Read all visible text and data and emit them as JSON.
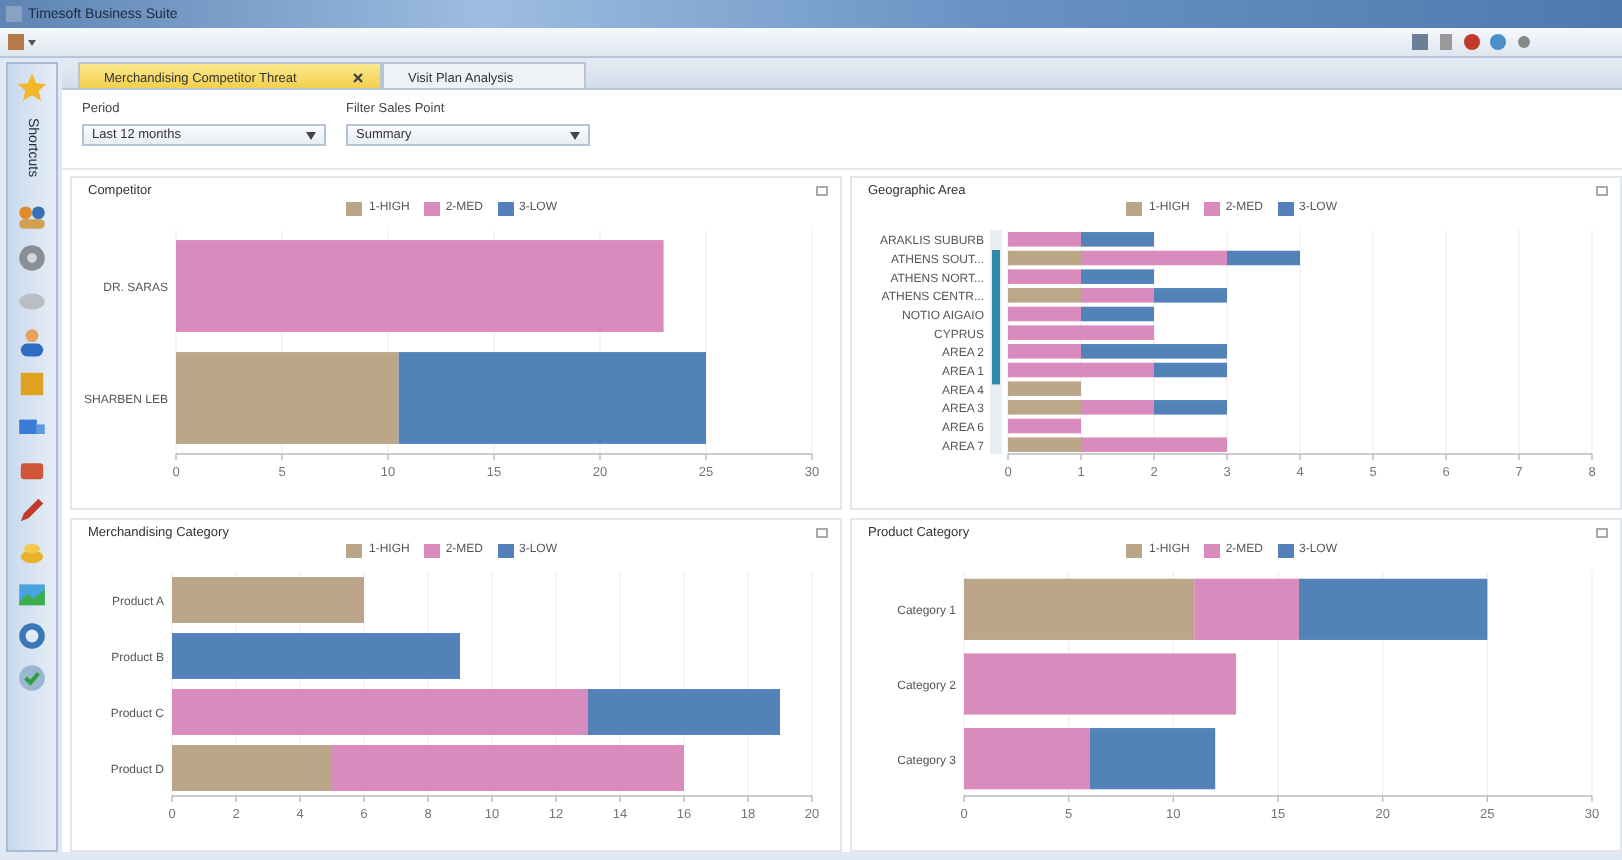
{
  "window": {
    "title": "Timesoft Business Suite"
  },
  "sidebar": {
    "title": "Shortcuts"
  },
  "tabs": [
    {
      "label": "Merchandising Competitor Threat",
      "selected": true
    },
    {
      "label": "Visit Plan Analysis",
      "selected": false
    }
  ],
  "filters": [
    {
      "label": "Period",
      "value": "Last 12 months"
    },
    {
      "label": "Filter Sales Point",
      "value": "Summary"
    }
  ],
  "panels": [
    {
      "title": "Competitor",
      "chart_data": {
        "type": "bar",
        "orientation": "horizontal",
        "stacked": true,
        "categories": [
          "DR. SARAS",
          "SHARBEN LEB"
        ],
        "series": [
          {
            "name": "1-HIGH",
            "color": "#bba68a",
            "values": [
              null,
              10.5
            ]
          },
          {
            "name": "2-MED",
            "color": "#d98bbd",
            "values": [
              23,
              null
            ]
          },
          {
            "name": "3-LOW",
            "color": "#5282b8",
            "values": [
              null,
              14.5
            ]
          }
        ],
        "xticks": [
          0,
          5,
          10,
          15,
          20,
          25,
          30
        ],
        "xlim": [
          0,
          30
        ],
        "grid": true
      }
    },
    {
      "title": "Geographic Area",
      "chart_data": {
        "type": "bar",
        "orientation": "horizontal",
        "stacked": true,
        "categories": [
          "ARAKLIS SUBURB",
          "ATHENS SOUT...",
          "ATHENS NORT...",
          "ATHENS CENTR...",
          "NOTIO AIGAIO",
          "CYPRUS",
          "AREA 2",
          "AREA 1",
          "AREA 4",
          "AREA 3",
          "AREA 6",
          "AREA 7"
        ],
        "series": [
          {
            "name": "1-HIGH",
            "color": "#bba68a",
            "values": [
              null,
              1,
              null,
              1,
              null,
              null,
              null,
              null,
              1,
              1,
              null,
              1
            ]
          },
          {
            "name": "2-MED",
            "color": "#d98bbd",
            "values": [
              1,
              2,
              1,
              1,
              1,
              2,
              1,
              2,
              null,
              1,
              1,
              2
            ]
          },
          {
            "name": "3-LOW",
            "color": "#5282b8",
            "values": [
              1,
              1,
              1,
              1,
              1,
              null,
              2,
              1,
              null,
              1,
              null,
              null
            ]
          }
        ],
        "xticks": [
          0,
          1,
          2,
          3,
          4,
          5,
          6,
          7,
          8
        ],
        "xlim": [
          0,
          8
        ],
        "grid": true
      }
    },
    {
      "title": "Merchandising Category",
      "chart_data": {
        "type": "bar",
        "orientation": "horizontal",
        "stacked": true,
        "categories": [
          "Product A",
          "Product B",
          "Product C",
          "Product D"
        ],
        "series": [
          {
            "name": "1-HIGH",
            "color": "#bba68a",
            "values": [
              6,
              null,
              null,
              5
            ]
          },
          {
            "name": "2-MED",
            "color": "#d98bbd",
            "values": [
              null,
              null,
              13,
              11
            ]
          },
          {
            "name": "3-LOW",
            "color": "#5282b8",
            "values": [
              null,
              9,
              6,
              null
            ]
          }
        ],
        "xticks": [
          0,
          2,
          4,
          6,
          8,
          10,
          12,
          14,
          16,
          18,
          20
        ],
        "xlim": [
          0,
          20
        ],
        "grid": true
      }
    },
    {
      "title": "Product Category",
      "chart_data": {
        "type": "bar",
        "orientation": "horizontal",
        "stacked": true,
        "categories": [
          "Category 1",
          "Category 2",
          "Category 3"
        ],
        "series": [
          {
            "name": "1-HIGH",
            "color": "#bba68a",
            "values": [
              11,
              null,
              null
            ]
          },
          {
            "name": "2-MED",
            "color": "#d98bbd",
            "values": [
              5,
              13,
              6
            ]
          },
          {
            "name": "3-LOW",
            "color": "#5282b8",
            "values": [
              9,
              null,
              6
            ]
          }
        ],
        "xticks": [
          0,
          5,
          10,
          15,
          20,
          25,
          30
        ],
        "xlim": [
          0,
          30
        ],
        "grid": true
      }
    }
  ]
}
